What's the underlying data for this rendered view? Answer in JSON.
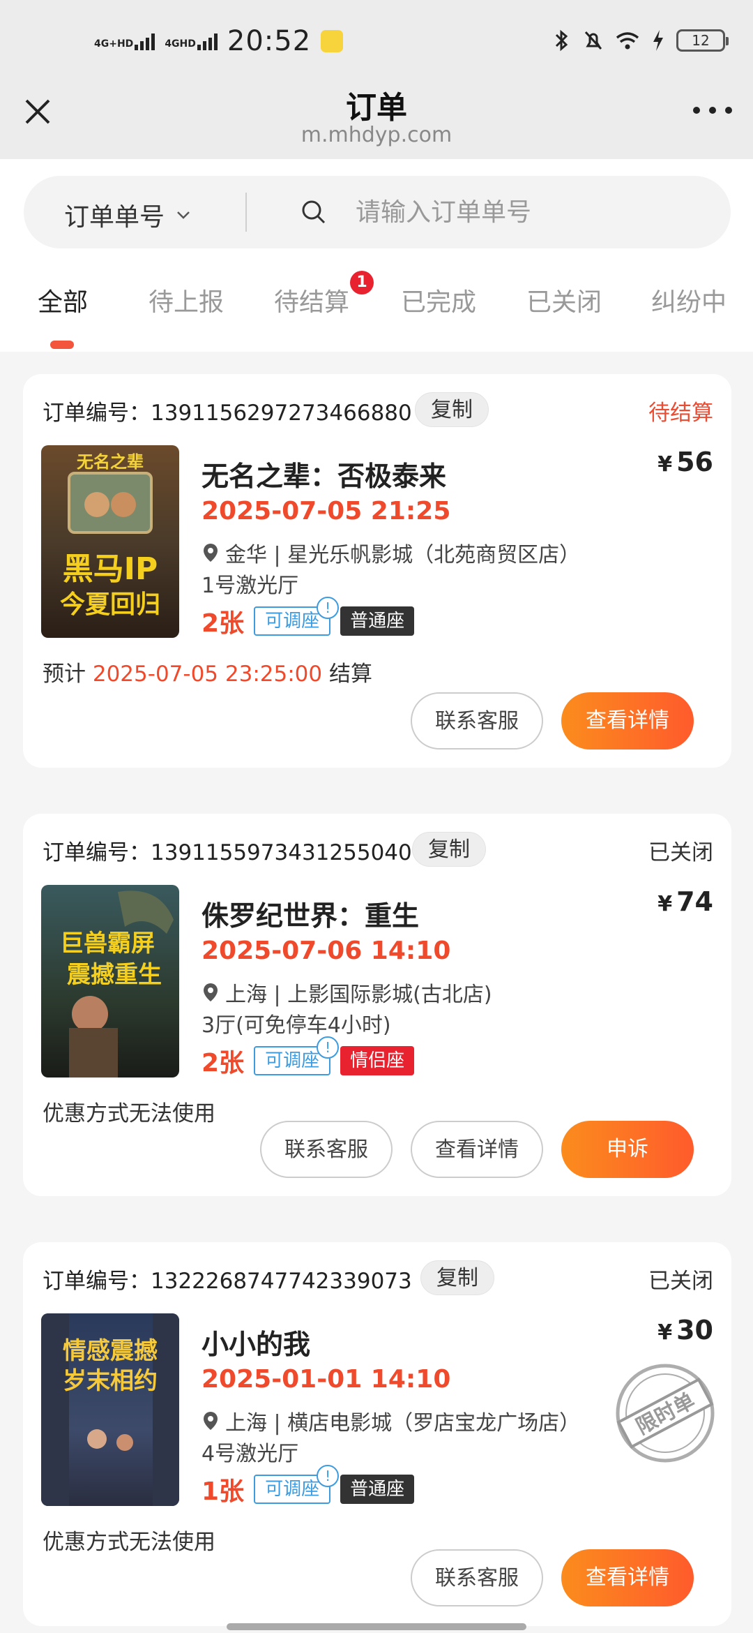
{
  "status_bar": {
    "net1": "4G+HD",
    "net2": "4GHD",
    "time": "20:52",
    "battery": "12"
  },
  "header": {
    "title": "订单",
    "subtitle": "m.mhdyp.com"
  },
  "search": {
    "select_label": "订单单号",
    "placeholder": "请输入订单单号"
  },
  "tabs": [
    {
      "label": "全部",
      "active": true
    },
    {
      "label": "待上报"
    },
    {
      "label": "待结算",
      "badge": "1"
    },
    {
      "label": "已完成"
    },
    {
      "label": "已关闭"
    },
    {
      "label": "纠纷中"
    }
  ],
  "orders": [
    {
      "order_label": "订单编号：1391156297273466880",
      "copy_label": "复制",
      "status": "待结算",
      "poster_text1": "无名之辈",
      "poster_text2": "黑马IP",
      "poster_text3": "今夏回归",
      "title": "无名之辈：否极泰来",
      "price": "56",
      "currency": "¥",
      "showtime": "2025-07-05 21:25",
      "location": "金华 | 星光乐帆影城（北苑商贸区店）",
      "hall": "1号激光厅",
      "tickets": "2张",
      "adjust_tag": "可调座",
      "seat_type": "普通座",
      "note_prefix": "预计 ",
      "note_highlight": "2025-07-05 23:25:00",
      "note_suffix": " 结算",
      "buttons": [
        "联系客服",
        "查看详情"
      ]
    },
    {
      "order_label": "订单编号：1391155973431255040",
      "copy_label": "复制",
      "status": "已关闭",
      "poster_text1": "巨兽霸屏",
      "poster_text2": "震撼重生",
      "title": "侏罗纪世界：重生",
      "price": "74",
      "currency": "¥",
      "showtime": "2025-07-06 14:10",
      "location": "上海 | 上影国际影城(古北店)",
      "hall": "3厅(可免停车4小时)",
      "tickets": "2张",
      "adjust_tag": "可调座",
      "seat_type": "情侣座",
      "note": "优惠方式无法使用",
      "buttons": [
        "联系客服",
        "查看详情",
        "申诉"
      ]
    },
    {
      "order_label": "订单编号：1322268747742339073",
      "copy_label": "复制",
      "status": "已关闭",
      "poster_text1": "情感震撼",
      "poster_text2": "岁末相约",
      "title": "小小的我",
      "price": "30",
      "currency": "¥",
      "showtime": "2025-01-01 14:10",
      "location": "上海 | 横店电影城（罗店宝龙广场店）",
      "hall": "4号激光厅",
      "tickets": "1张",
      "adjust_tag": "可调座",
      "seat_type": "普通座",
      "stamp": "限时单",
      "note": "优惠方式无法使用",
      "buttons": [
        "联系客服",
        "查看详情"
      ]
    }
  ],
  "colors": {
    "accent": "#ef4a2c",
    "primary_button_start": "#fb8c1d",
    "primary_button_end": "#ff5b2c",
    "tag_blue": "#3d9be0",
    "couple_red": "#e8222f"
  }
}
